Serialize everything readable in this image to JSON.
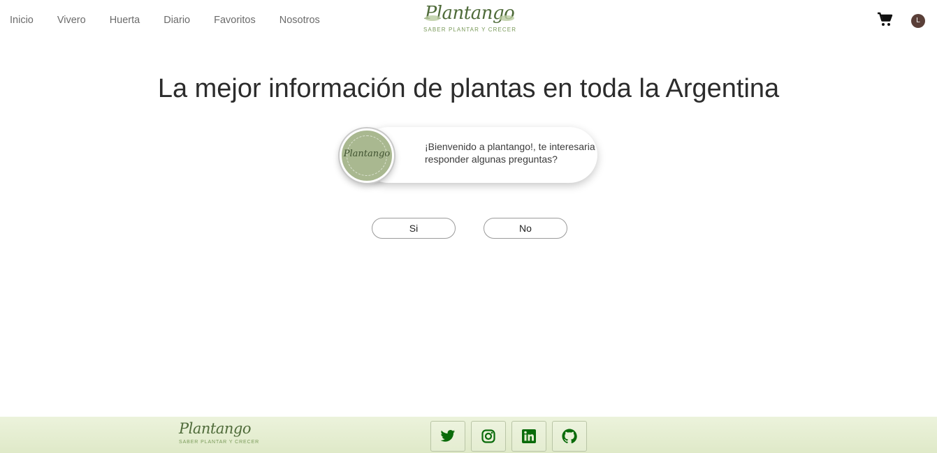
{
  "nav": {
    "items": [
      {
        "label": "Inicio"
      },
      {
        "label": "Vivero"
      },
      {
        "label": "Huerta"
      },
      {
        "label": "Diario"
      },
      {
        "label": "Favoritos"
      },
      {
        "label": "Nosotros"
      }
    ]
  },
  "brand": {
    "name": "Plantango",
    "tagline": "SABER PLANTAR Y CRECER"
  },
  "header": {
    "cart_icon": "shopping-cart-icon",
    "avatar_initial": "L"
  },
  "hero": {
    "title": "La mejor información de plantas en toda la Argentina"
  },
  "chat": {
    "bot_name": "Plantango",
    "message": "¡Bienvenido a plantango!, te interesaria responder algunas preguntas?",
    "yes_label": "Si",
    "no_label": "No"
  },
  "footer": {
    "brand_name": "Plantango",
    "brand_tagline": "SABER PLANTAR Y CRECER",
    "social": [
      {
        "icon": "twitter-icon"
      },
      {
        "icon": "instagram-icon"
      },
      {
        "icon": "linkedin-icon"
      },
      {
        "icon": "github-icon"
      }
    ]
  },
  "colors": {
    "accent_green": "#0a6b0a",
    "footer_bg": "#e4edd0",
    "avatar_bg": "#5a3f38",
    "bot_bg": "#a9b890"
  }
}
